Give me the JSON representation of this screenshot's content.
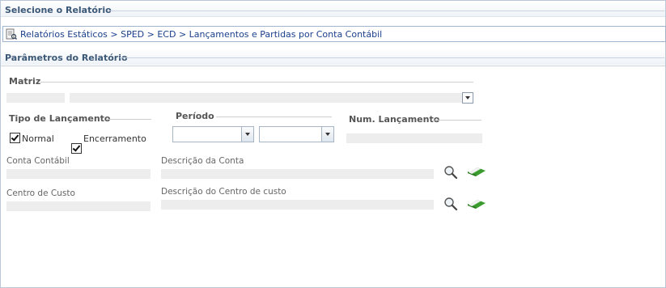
{
  "select_section": {
    "title": "Selecione o Relatório"
  },
  "breadcrumb": {
    "text": "Relatórios Estáticos > SPED > ECD > Lançamentos e Partidas por Conta Contábil"
  },
  "params_section": {
    "title": "Parâmetros do Relatório"
  },
  "matriz": {
    "label": "Matriz"
  },
  "tipo_lancamento": {
    "label": "Tipo de Lançamento",
    "options": [
      {
        "label": "Normal",
        "checked": true
      },
      {
        "label": "Encerramento",
        "checked": true
      }
    ]
  },
  "periodo": {
    "label": "Período"
  },
  "num_lancamento": {
    "label": "Num. Lançamento"
  },
  "conta_contabil": {
    "label": "Conta Contábil",
    "desc_label": "Descrição da Conta"
  },
  "centro_custo": {
    "label": "Centro de Custo",
    "desc_label": "Descrição do Centro de custo"
  },
  "icons": {
    "search": "magnifier-icon",
    "clear": "eraser-icon"
  }
}
